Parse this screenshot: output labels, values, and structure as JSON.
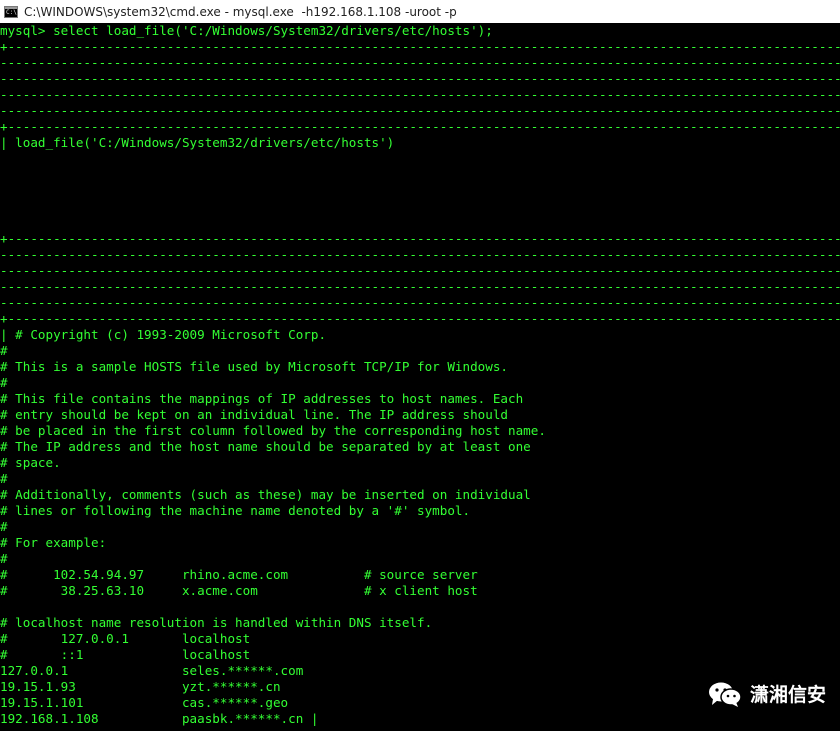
{
  "window": {
    "title": "C:\\WINDOWS\\system32\\cmd.exe - mysql.exe  -h192.168.1.108 -uroot -p"
  },
  "console": {
    "lines": [
      {
        "type": "text",
        "text": "mysql> select load_file('C:/Windows/System32/drivers/etc/hosts');"
      },
      {
        "type": "border"
      },
      {
        "type": "dash"
      },
      {
        "type": "dash"
      },
      {
        "type": "dash"
      },
      {
        "type": "dash"
      },
      {
        "type": "border"
      },
      {
        "type": "text",
        "text": "| load_file('C:/Windows/System32/drivers/etc/hosts')"
      },
      {
        "type": "text",
        "text": ""
      },
      {
        "type": "text",
        "text": ""
      },
      {
        "type": "text",
        "text": ""
      },
      {
        "type": "text",
        "text": ""
      },
      {
        "type": "text",
        "text": "                                                                                                                                  |"
      },
      {
        "type": "border"
      },
      {
        "type": "dash"
      },
      {
        "type": "dash"
      },
      {
        "type": "dash"
      },
      {
        "type": "dash"
      },
      {
        "type": "border"
      },
      {
        "type": "text",
        "text": "| # Copyright (c) 1993-2009 Microsoft Corp."
      },
      {
        "type": "text",
        "text": "#"
      },
      {
        "type": "text",
        "text": "# This is a sample HOSTS file used by Microsoft TCP/IP for Windows."
      },
      {
        "type": "text",
        "text": "#"
      },
      {
        "type": "text",
        "text": "# This file contains the mappings of IP addresses to host names. Each"
      },
      {
        "type": "text",
        "text": "# entry should be kept on an individual line. The IP address should"
      },
      {
        "type": "text",
        "text": "# be placed in the first column followed by the corresponding host name."
      },
      {
        "type": "text",
        "text": "# The IP address and the host name should be separated by at least one"
      },
      {
        "type": "text",
        "text": "# space."
      },
      {
        "type": "text",
        "text": "#"
      },
      {
        "type": "text",
        "text": "# Additionally, comments (such as these) may be inserted on individual"
      },
      {
        "type": "text",
        "text": "# lines or following the machine name denoted by a '#' symbol."
      },
      {
        "type": "text",
        "text": "#"
      },
      {
        "type": "text",
        "text": "# For example:"
      },
      {
        "type": "text",
        "text": "#"
      },
      {
        "type": "text",
        "text": "#      102.54.94.97     rhino.acme.com          # source server"
      },
      {
        "type": "text",
        "text": "#       38.25.63.10     x.acme.com              # x client host"
      },
      {
        "type": "text",
        "text": ""
      },
      {
        "type": "text",
        "text": "# localhost name resolution is handled within DNS itself."
      },
      {
        "type": "text",
        "text": "#       127.0.0.1       localhost"
      },
      {
        "type": "text",
        "text": "#       ::1             localhost"
      },
      {
        "type": "text",
        "text": "127.0.0.1               seles.******.com"
      },
      {
        "type": "text",
        "text": "19.15.1.93              yzt.******.cn"
      },
      {
        "type": "text",
        "text": "19.15.1.101             cas.******.geo"
      },
      {
        "type": "text",
        "text": "192.168.1.108           paasbk.******.cn |"
      }
    ]
  },
  "watermark": {
    "text": "潇湘信安",
    "icon": "wechat-icon"
  },
  "colors": {
    "console_text": "#33ff33",
    "background": "#000000",
    "titlebar": "#ffffff"
  }
}
